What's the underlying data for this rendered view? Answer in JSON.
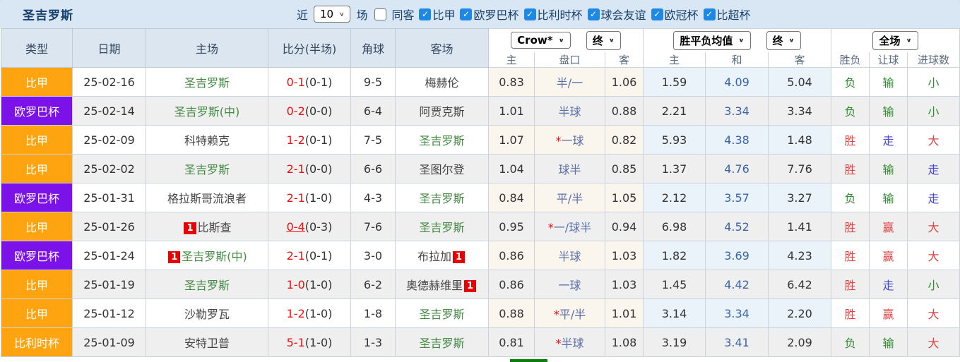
{
  "header_bar": {
    "title": "圣吉罗斯",
    "recent_label": "近",
    "recent_count": "10",
    "matches_label": "场",
    "same_venue_label": "同客",
    "same_venue_checked": false,
    "league_filters": [
      {
        "label": "比甲",
        "checked": true
      },
      {
        "label": "欧罗巴杯",
        "checked": true
      },
      {
        "label": "比利时杯",
        "checked": true
      },
      {
        "label": "球会友谊",
        "checked": true
      },
      {
        "label": "欧冠杯",
        "checked": true
      },
      {
        "label": "比超杯",
        "checked": true
      }
    ]
  },
  "table": {
    "columns": [
      "类型",
      "日期",
      "主场",
      "比分(半场)",
      "角球",
      "客场"
    ],
    "dropdowns": {
      "asian_company": "Crow*",
      "asian_time": "终",
      "europe_company": "胜平负均值",
      "europe_time": "终",
      "scope": "全场"
    },
    "sub_headers": [
      "主",
      "盘口",
      "客",
      "主",
      "和",
      "客",
      "胜负",
      "让球",
      "进球数"
    ],
    "rows": [
      {
        "league": "比甲",
        "league_color": "orange",
        "date": "25-02-16",
        "home": "圣吉罗斯",
        "home_focus": true,
        "home_badge": "",
        "score_ft": "0-1",
        "score_ht": "(0-1)",
        "score_link": false,
        "corners": "9-5",
        "away": "梅赫伦",
        "away_focus": false,
        "away_badge": "",
        "asian_home": "0.83",
        "handicap": "半/一",
        "asian_away": "1.06",
        "euro_home": "1.59",
        "euro_draw": "4.09",
        "euro_away": "5.04",
        "result": "负",
        "result_color": "green",
        "handicap_result": "输",
        "handicap_result_color": "green",
        "goals": "小",
        "goals_color": "green"
      },
      {
        "league": "欧罗巴杯",
        "league_color": "purple",
        "date": "25-02-14",
        "home": "圣吉罗斯(中)",
        "home_focus": true,
        "home_badge": "",
        "score_ft": "0-2",
        "score_ht": "(0-0)",
        "score_link": false,
        "corners": "6-4",
        "away": "阿贾克斯",
        "away_focus": false,
        "away_badge": "",
        "asian_home": "1.01",
        "handicap": "半球",
        "asian_away": "0.88",
        "euro_home": "2.21",
        "euro_draw": "3.34",
        "euro_away": "3.34",
        "result": "负",
        "result_color": "green",
        "handicap_result": "输",
        "handicap_result_color": "green",
        "goals": "小",
        "goals_color": "green"
      },
      {
        "league": "比甲",
        "league_color": "orange",
        "date": "25-02-09",
        "home": "科特赖克",
        "home_focus": false,
        "home_badge": "",
        "score_ft": "1-2",
        "score_ht": "(0-1)",
        "score_link": false,
        "corners": "7-5",
        "away": "圣吉罗斯",
        "away_focus": true,
        "away_badge": "",
        "asian_home": "1.07",
        "handicap": "*一球",
        "asian_away": "0.82",
        "euro_home": "5.93",
        "euro_draw": "4.38",
        "euro_away": "1.48",
        "result": "胜",
        "result_color": "red",
        "handicap_result": "走",
        "handicap_result_color": "blue",
        "goals": "大",
        "goals_color": "red"
      },
      {
        "league": "比甲",
        "league_color": "orange",
        "date": "25-02-02",
        "home": "圣吉罗斯",
        "home_focus": true,
        "home_badge": "",
        "score_ft": "2-1",
        "score_ht": "(0-0)",
        "score_link": false,
        "corners": "6-6",
        "away": "圣图尔登",
        "away_focus": false,
        "away_badge": "",
        "asian_home": "1.04",
        "handicap": "球半",
        "asian_away": "0.85",
        "euro_home": "1.37",
        "euro_draw": "4.76",
        "euro_away": "7.76",
        "result": "胜",
        "result_color": "red",
        "handicap_result": "输",
        "handicap_result_color": "green",
        "goals": "走",
        "goals_color": "blue"
      },
      {
        "league": "欧罗巴杯",
        "league_color": "purple",
        "date": "25-01-31",
        "home": "格拉斯哥流浪者",
        "home_focus": false,
        "home_badge": "",
        "score_ft": "2-1",
        "score_ht": "(1-0)",
        "score_link": false,
        "corners": "4-3",
        "away": "圣吉罗斯",
        "away_focus": true,
        "away_badge": "",
        "asian_home": "0.84",
        "handicap": "平/半",
        "asian_away": "1.05",
        "euro_home": "2.12",
        "euro_draw": "3.57",
        "euro_away": "3.27",
        "result": "负",
        "result_color": "green",
        "handicap_result": "输",
        "handicap_result_color": "green",
        "goals": "走",
        "goals_color": "blue"
      },
      {
        "league": "比甲",
        "league_color": "orange",
        "date": "25-01-26",
        "home": "比斯查",
        "home_focus": false,
        "home_badge": "1",
        "score_ft": "0-4",
        "score_ht": "(0-3)",
        "score_link": true,
        "corners": "7-6",
        "away": "圣吉罗斯",
        "away_focus": true,
        "away_badge": "",
        "asian_home": "0.95",
        "handicap": "*一/球半",
        "asian_away": "0.94",
        "euro_home": "6.98",
        "euro_draw": "4.52",
        "euro_away": "1.41",
        "result": "胜",
        "result_color": "red",
        "handicap_result": "赢",
        "handicap_result_color": "red",
        "goals": "大",
        "goals_color": "red"
      },
      {
        "league": "欧罗巴杯",
        "league_color": "purple",
        "date": "25-01-24",
        "home": "圣吉罗斯(中)",
        "home_focus": true,
        "home_badge": "1",
        "score_ft": "2-1",
        "score_ht": "(0-1)",
        "score_link": false,
        "corners": "3-0",
        "away": "布拉加",
        "away_focus": false,
        "away_badge": "1",
        "asian_home": "0.86",
        "handicap": "半球",
        "asian_away": "1.03",
        "euro_home": "1.82",
        "euro_draw": "3.69",
        "euro_away": "4.23",
        "result": "胜",
        "result_color": "red",
        "handicap_result": "赢",
        "handicap_result_color": "red",
        "goals": "大",
        "goals_color": "red"
      },
      {
        "league": "比甲",
        "league_color": "orange",
        "date": "25-01-19",
        "home": "圣吉罗斯",
        "home_focus": true,
        "home_badge": "",
        "score_ft": "1-0",
        "score_ht": "(1-0)",
        "score_link": false,
        "corners": "6-2",
        "away": "奥德赫维里",
        "away_focus": false,
        "away_badge": "1",
        "asian_home": "0.86",
        "handicap": "一球",
        "asian_away": "1.03",
        "euro_home": "1.45",
        "euro_draw": "4.42",
        "euro_away": "6.42",
        "result": "胜",
        "result_color": "red",
        "handicap_result": "走",
        "handicap_result_color": "blue",
        "goals": "小",
        "goals_color": "green"
      },
      {
        "league": "比甲",
        "league_color": "orange",
        "date": "25-01-12",
        "home": "沙勒罗瓦",
        "home_focus": false,
        "home_badge": "",
        "score_ft": "1-2",
        "score_ht": "(1-0)",
        "score_link": false,
        "corners": "1-8",
        "away": "圣吉罗斯",
        "away_focus": true,
        "away_badge": "",
        "asian_home": "0.88",
        "handicap": "*平/半",
        "asian_away": "1.01",
        "euro_home": "3.14",
        "euro_draw": "3.34",
        "euro_away": "2.20",
        "result": "胜",
        "result_color": "red",
        "handicap_result": "赢",
        "handicap_result_color": "red",
        "goals": "大",
        "goals_color": "red"
      },
      {
        "league": "比利时杯",
        "league_color": "orange",
        "date": "25-01-09",
        "home": "安特卫普",
        "home_focus": false,
        "home_badge": "",
        "score_ft": "5-1",
        "score_ht": "(1-0)",
        "score_link": false,
        "corners": "1-3",
        "away": "圣吉罗斯",
        "away_focus": true,
        "away_badge": "",
        "asian_home": "0.81",
        "handicap": "*半球",
        "asian_away": "1.08",
        "euro_home": "3.19",
        "euro_draw": "3.41",
        "euro_away": "2.09",
        "result": "负",
        "result_color": "green",
        "handicap_result": "输",
        "handicap_result_color": "green",
        "goals": "大",
        "goals_color": "red"
      }
    ]
  },
  "colors": {
    "league_badge_orange": "#ffa411",
    "league_badge_purple": "#7b12e9",
    "focus_team_green": "#438a43",
    "score_red": "#f20d0d",
    "handicap_blue": "#5b6fa8",
    "draw_odds_blue": "#3a63ad",
    "result_red": "#e04343",
    "result_green": "#2f8b2f",
    "result_blue": "#4646d8",
    "asian_col_bg": "#faf5ed",
    "europe_col_bg": "#e9f3f9",
    "header_bg": "#dce6f1",
    "topbar_bg": "#d9e6f3",
    "row_alt_bg": "#efefef",
    "checkbox_blue": "#1e88e5",
    "red_card_badge": "#e60000",
    "green_bar": "#0b7d0b"
  }
}
